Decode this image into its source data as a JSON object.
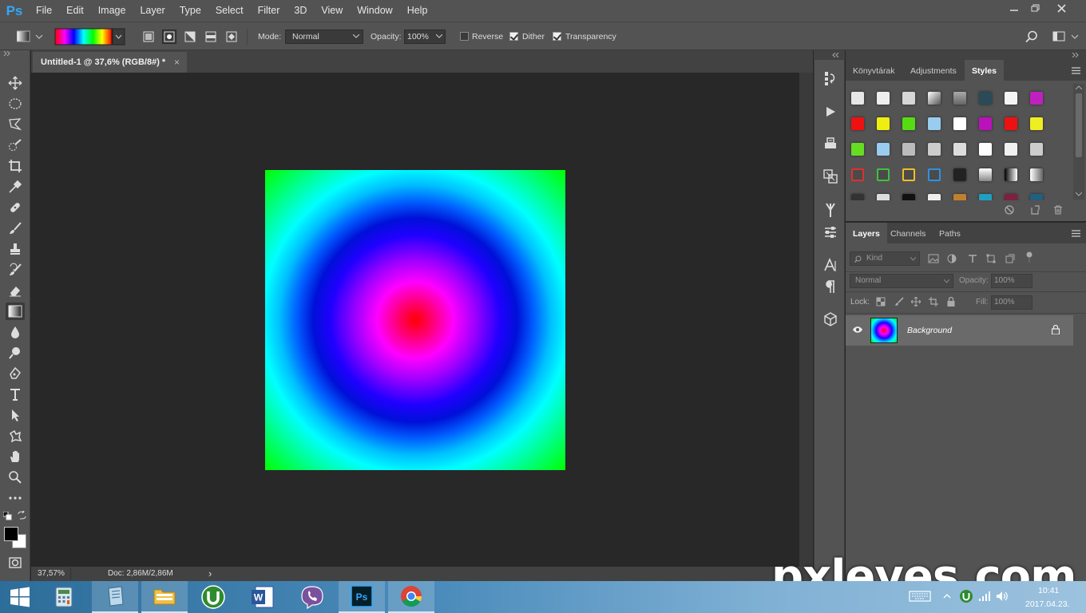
{
  "app": {
    "logo": "Ps"
  },
  "menu": [
    "File",
    "Edit",
    "Image",
    "Layer",
    "Type",
    "Select",
    "Filter",
    "3D",
    "View",
    "Window",
    "Help"
  ],
  "options_bar": {
    "mode_label": "Mode:",
    "mode_value": "Normal",
    "opacity_label": "Opacity:",
    "opacity_value": "100%",
    "reverse_label": "Reverse",
    "reverse_checked": false,
    "dither_label": "Dither",
    "dither_checked": true,
    "transparency_label": "Transparency",
    "transparency_checked": true
  },
  "document": {
    "tab_title": "Untitled-1 @ 37,6% (RGB/8#) *",
    "close_symbol": "×"
  },
  "status": {
    "zoom": "37,57%",
    "doc_info": "Doc: 2,86M/2,86M",
    "arrow": "›"
  },
  "styles_panel": {
    "tabs": [
      "Könyvtárak",
      "Adjustments",
      "Styles"
    ],
    "active_tab": "Styles"
  },
  "layers_panel": {
    "tabs": [
      "Layers",
      "Channels",
      "Paths"
    ],
    "active_tab": "Layers",
    "filter_placeholder": "Kind",
    "blend_mode": "Normal",
    "opacity_label": "Opacity:",
    "opacity_value": "100%",
    "lock_label": "Lock:",
    "fill_label": "Fill:",
    "fill_value": "100%",
    "layers": [
      {
        "name": "Background",
        "visible": true,
        "locked": true
      }
    ]
  },
  "taskbar": {
    "time": "10:41",
    "date": "2017.04.23.",
    "ps_label": "Ps",
    "word_label": "W"
  },
  "watermark": "pxleyes.com",
  "colors": {
    "accent_ps": "#31a8ff",
    "panel": "#535353",
    "canvas_bg": "#282828"
  }
}
